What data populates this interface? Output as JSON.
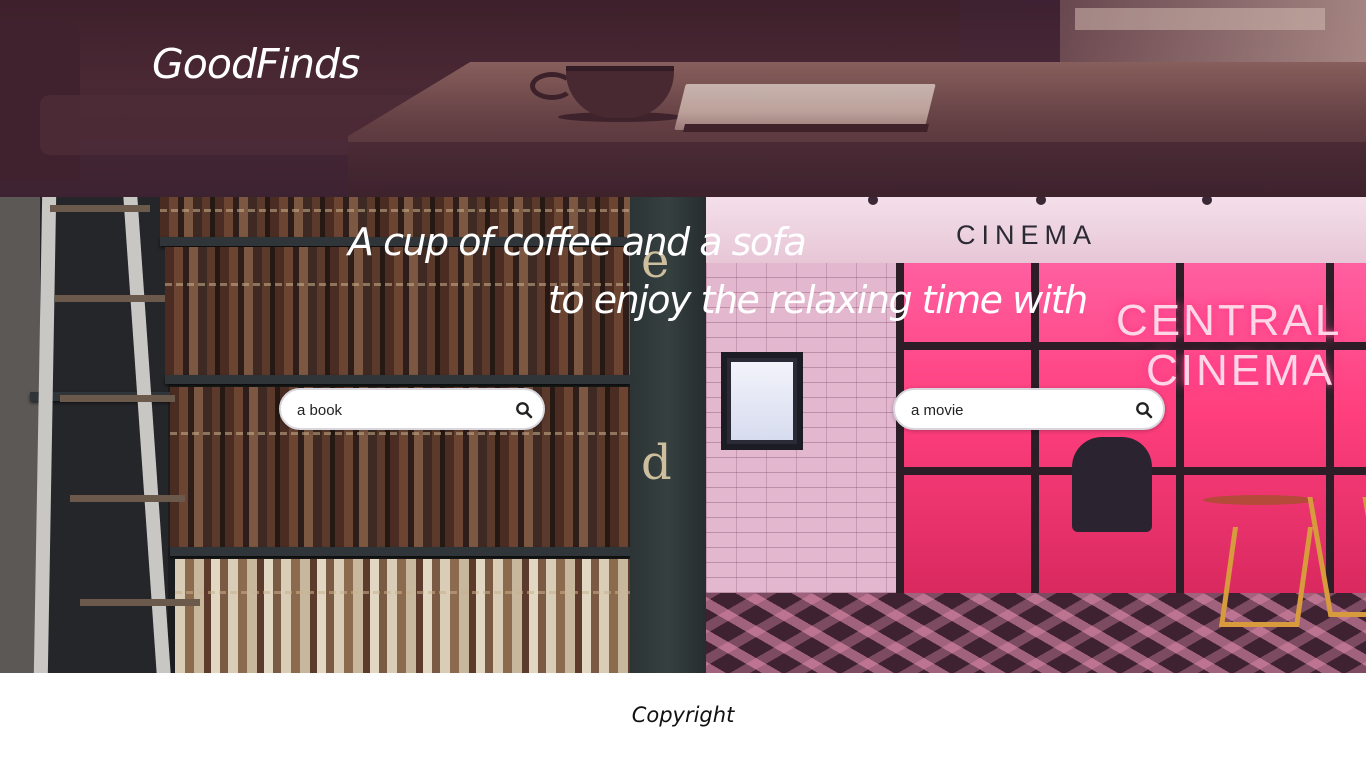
{
  "header": {
    "brand": "GoodFinds"
  },
  "hero": {
    "tagline_line1": "A cup of coffee and a sofa",
    "tagline_line2": "to enjoy the relaxing time with"
  },
  "book_panel": {
    "pillar_letters": [
      "e",
      "d"
    ],
    "search": {
      "value": "a book",
      "icon": "search-icon"
    }
  },
  "movie_panel": {
    "sign_text": "CINEMA",
    "neon_line1": "CENTRAL",
    "neon_line2": "CINEMA",
    "search": {
      "value": "a movie",
      "icon": "search-icon"
    }
  },
  "footer": {
    "copyright": "Copyright"
  },
  "colors": {
    "header_tint": "#4a2c38",
    "neon_pink": "#ff3f7e",
    "text_light": "#ffffff"
  }
}
